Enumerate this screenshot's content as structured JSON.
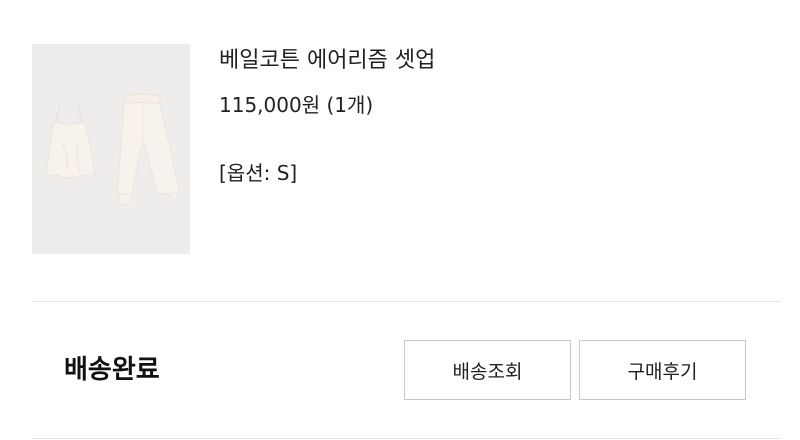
{
  "order_item": {
    "product_image": "product-photo-camisole-and-jogger-set",
    "product_name": "베일코튼 에어리즘 셋업",
    "price": "115,000원 (1개)",
    "option": "[옵션: S]"
  },
  "order_status": {
    "status_label": "배송완료",
    "buttons": {
      "track_delivery": "배송조회",
      "write_review": "구매후기"
    }
  },
  "colors": {
    "thumbnail_background": "#eeedec",
    "garment": "#f7f2ec",
    "divider": "#e4e4e4",
    "button_border": "#c8c8c8",
    "text": "#222222"
  }
}
